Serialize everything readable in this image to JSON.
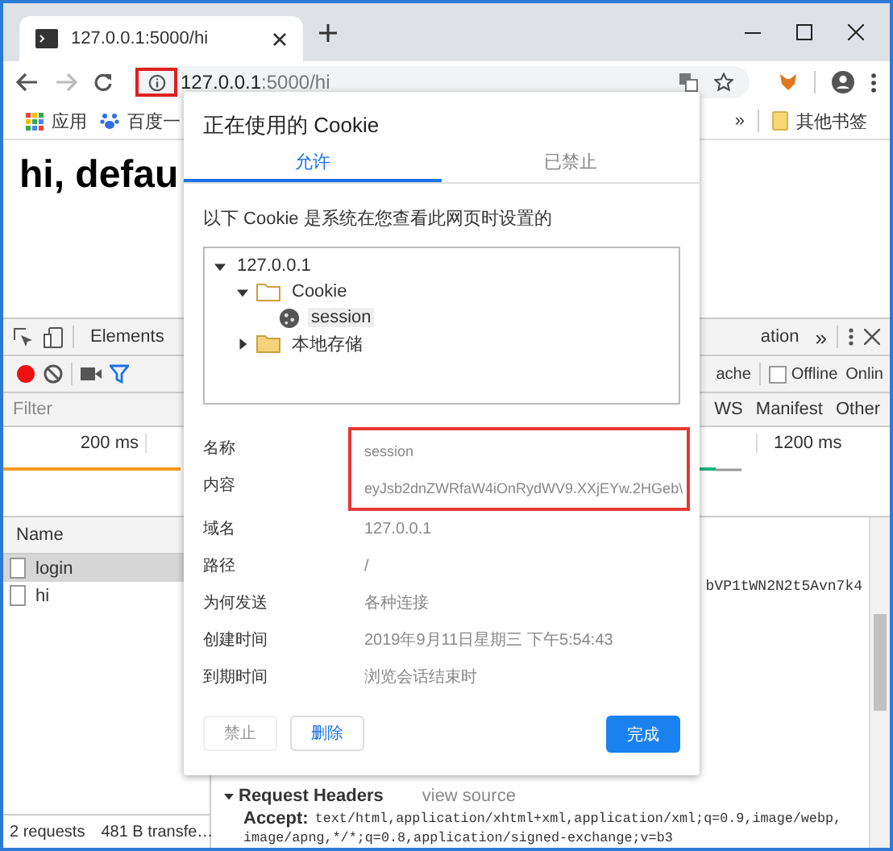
{
  "browser_tab": {
    "title": "127.0.0.1:5000/hi"
  },
  "address_bar": {
    "host": "127.0.0.1",
    "path": ":5000/hi",
    "site_info_highlighted": true
  },
  "bookmarks": [
    {
      "label": "应用",
      "kind": "apps"
    },
    {
      "label": "百度一",
      "kind": "paw"
    }
  ],
  "bookmarks_overflow": "»",
  "other_bookmarks": "其他书签",
  "page_heading": "hi, defau",
  "devtools": {
    "tabs": [
      {
        "label": "Elements",
        "selected": false
      },
      {
        "label": "ation",
        "selected": false
      }
    ],
    "more_tabs": "»",
    "recording": true,
    "cache_label": "ache",
    "offline": {
      "label": "Offline",
      "checked": false
    },
    "online_label": "Onlin",
    "filter_placeholder": "Filter",
    "type_filters": [
      "WS",
      "Manifest",
      "Other"
    ],
    "timeline_ticks": [
      "200 ms",
      "1200 ms"
    ],
    "name_header": "Name",
    "requests": [
      {
        "name": "login",
        "selected": true
      },
      {
        "name": "hi",
        "selected": false
      }
    ],
    "summary": "2 requests",
    "transferred": "481 B transfe…",
    "detail_fragment": "bVP1tWN2N2t5Avn7k4",
    "section_title": "Request Headers",
    "view_source": "view source",
    "accept_header": {
      "name": "Accept:",
      "lines": [
        "text/html,application/xhtml+xml,application/xml;q=0.9,image/webp,",
        "image/apng,*/*;q=0.8,application/signed-exchange;v=b3"
      ]
    }
  },
  "cookie_dialog": {
    "title": "正在使用的 Cookie",
    "tabs": [
      {
        "label": "允许",
        "selected": true
      },
      {
        "label": "已禁止",
        "selected": false
      }
    ],
    "description": "以下 Cookie 是系统在您查看此网页时设置的",
    "tree": [
      {
        "label": "127.0.0.1",
        "expanded": true,
        "selected": false,
        "children": [
          {
            "label": "Cookie",
            "kind": "folder",
            "expanded": true,
            "selected": false,
            "children": [
              {
                "label": "session",
                "kind": "cookie",
                "selected": true
              }
            ]
          },
          {
            "label": "本地存储",
            "kind": "folder",
            "expanded": false,
            "selected": false
          }
        ]
      }
    ],
    "details": [
      {
        "label": "名称",
        "value": "session",
        "highlighted": true
      },
      {
        "label": "内容",
        "value": "eyJsb2dnZWRfaW4iOnRydWV9.XXjEYw.2HGeb\\",
        "highlighted": true
      },
      {
        "label": "域名",
        "value": "127.0.0.1",
        "highlighted": false
      },
      {
        "label": "路径",
        "value": "/",
        "highlighted": false
      },
      {
        "label": "为何发送",
        "value": "各种连接",
        "highlighted": false
      },
      {
        "label": "创建时间",
        "value": "2019年9月11日星期三 下午5:54:43",
        "highlighted": false
      },
      {
        "label": "到期时间",
        "value": "浏览会话结束时",
        "highlighted": false
      }
    ],
    "buttons": [
      {
        "label": "禁止",
        "kind": "secondary",
        "disabled": true
      },
      {
        "label": "删除",
        "kind": "secondary",
        "disabled": false
      },
      {
        "label": "完成",
        "kind": "primary",
        "disabled": false
      }
    ]
  }
}
